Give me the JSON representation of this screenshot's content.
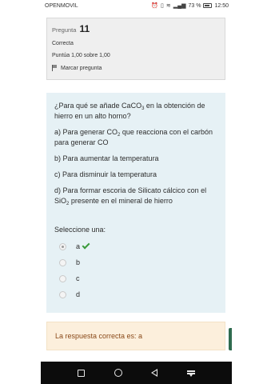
{
  "statusbar": {
    "carrier": "OPENMOVIL",
    "icons": [
      "alarm-icon",
      "vibrate-icon",
      "wifi-icon",
      "signal-icon"
    ],
    "battery": "73 %",
    "time": "12:50"
  },
  "info": {
    "label": "Pregunta",
    "number": "11",
    "status": "Correcta",
    "score": "Puntúa 1,00 sobre 1,00",
    "flag_label": "Marcar pregunta"
  },
  "question": {
    "text_pre": "¿Para qué se añade CaCO",
    "text_sub": "3",
    "text_post": " en la obtención de hierro en un alto horno?",
    "options": {
      "a_pre": "a) Para generar CO",
      "a_sub": "2",
      "a_post": " que reacciona  con el carbón para generar CO",
      "b": "b) Para aumentar la temperatura",
      "c": "c) Para disminuir la temperatura",
      "d_pre": "d) Para formar escoria de Silicato cálcico con el SiO",
      "d_sub": "2",
      "d_post": " presente en el mineral de hierro"
    },
    "select_label": "Seleccione una:",
    "answers": [
      {
        "label": "a",
        "selected": true,
        "correct": true
      },
      {
        "label": "b",
        "selected": false
      },
      {
        "label": "c",
        "selected": false
      },
      {
        "label": "d",
        "selected": false
      }
    ]
  },
  "feedback": {
    "text": "La respuesta correcta es: a"
  },
  "colors": {
    "question_bg": "#e6f1f5",
    "feedback_bg": "#fcefdc",
    "feedback_text": "#8a4a1a",
    "correct_check": "#3a9a3a"
  }
}
